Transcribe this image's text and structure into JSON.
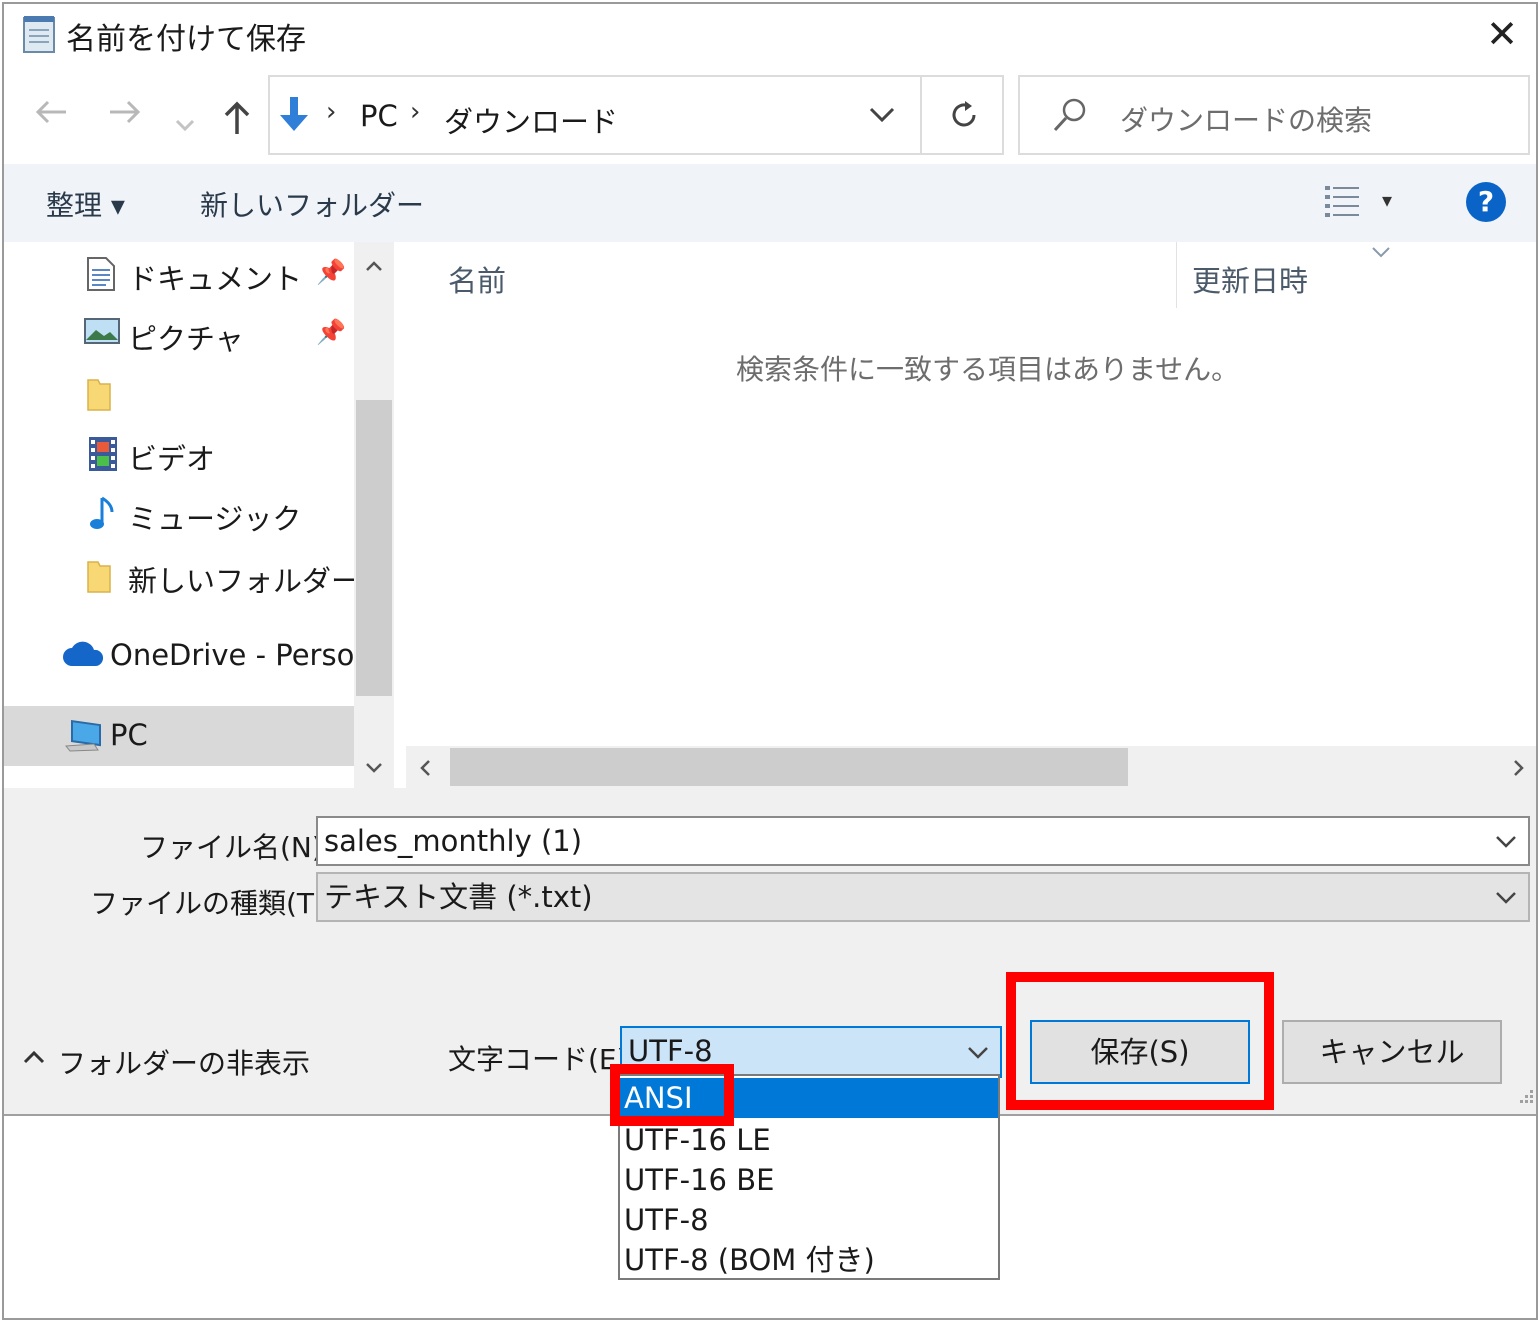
{
  "window": {
    "title": "名前を付けて保存",
    "close_icon": "close-icon"
  },
  "nav": {
    "back_icon": "back-arrow-icon",
    "forward_icon": "forward-arrow-icon",
    "recent_icon": "recent-locations-chevron-icon",
    "up_icon": "up-arrow-icon"
  },
  "address": {
    "breadcrumb": [
      "PC",
      "ダウンロード"
    ],
    "dropdown_icon": "chevron-down-icon",
    "refresh_icon": "refresh-icon"
  },
  "search": {
    "placeholder": "ダウンロードの検索",
    "icon": "search-icon"
  },
  "toolbar": {
    "organize_label": "整理 ▾",
    "new_folder_label": "新しいフォルダー",
    "view_icon": "details-view-icon",
    "view_menu": "▾",
    "help_label": "?"
  },
  "nav_pane": {
    "items": [
      {
        "label": "ドキュメント",
        "icon": "document-icon",
        "pinned": true
      },
      {
        "label": "ピクチャ",
        "icon": "pictures-icon",
        "pinned": true
      },
      {
        "label": "",
        "icon": "folder-icon",
        "pinned": false
      },
      {
        "label": "ビデオ",
        "icon": "video-icon",
        "pinned": false
      },
      {
        "label": "ミュージック",
        "icon": "music-icon",
        "pinned": false
      },
      {
        "label": "新しいフォルダー",
        "icon": "folder-icon",
        "pinned": false
      },
      {
        "label": "OneDrive - Persor",
        "icon": "onedrive-cloud-icon",
        "pinned": false
      },
      {
        "label": "PC",
        "icon": "pc-icon",
        "pinned": false,
        "selected": true
      }
    ]
  },
  "content": {
    "columns": [
      "名前",
      "更新日時"
    ],
    "empty_message": "検索条件に一致する項目はありません。"
  },
  "form": {
    "filename_label": "ファイル名(N):",
    "filename_value": "sales_monthly (1)",
    "filetype_label": "ファイルの種類(T):",
    "filetype_value": "テキスト文書 (*.txt)",
    "hide_folders_label": "フォルダーの非表示",
    "encoding_label": "文字コード(E):",
    "encoding_value": "UTF-8",
    "encoding_options": [
      "ANSI",
      "UTF-16 LE",
      "UTF-16 BE",
      "UTF-8",
      "UTF-8 (BOM 付き)"
    ],
    "encoding_highlighted": "ANSI"
  },
  "buttons": {
    "save": "保存(S)",
    "cancel": "キャンセル"
  },
  "colors": {
    "accent": "#0078d7",
    "annotation": "#ff0000",
    "toolbar_bg": "#f0f4f9",
    "bottom_bg": "#f0f0f0"
  }
}
